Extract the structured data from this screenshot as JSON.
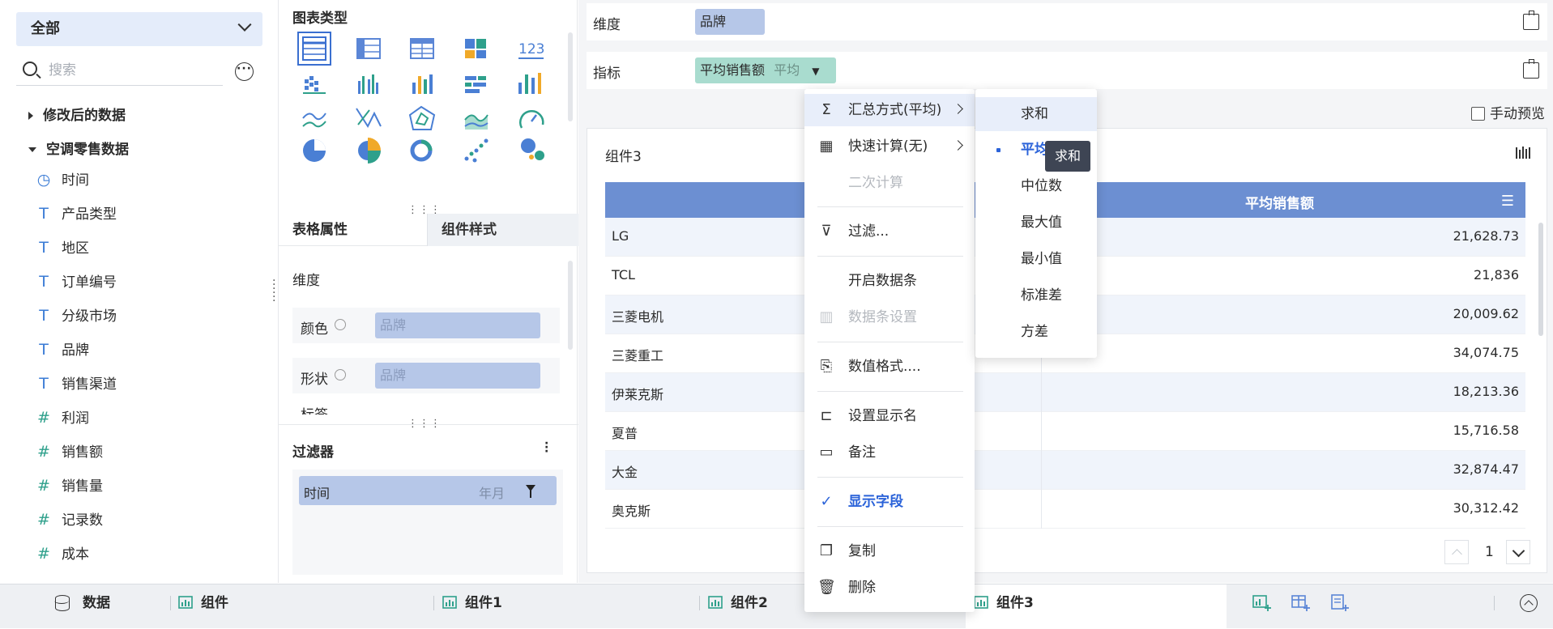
{
  "left": {
    "scope_select": "全部",
    "search_placeholder": "搜索",
    "groups": [
      {
        "label": "修改后的数据",
        "expanded": false
      },
      {
        "label": "空调零售数据",
        "expanded": true
      }
    ],
    "fields": [
      {
        "label": "时间",
        "icon": "clock-icon"
      },
      {
        "label": "产品类型",
        "icon": "text-field-icon"
      },
      {
        "label": "地区",
        "icon": "text-field-icon"
      },
      {
        "label": "订单编号",
        "icon": "text-field-icon"
      },
      {
        "label": "分级市场",
        "icon": "text-field-icon"
      },
      {
        "label": "品牌",
        "icon": "text-field-icon"
      },
      {
        "label": "销售渠道",
        "icon": "text-field-icon"
      },
      {
        "label": "利润",
        "icon": "number-field-icon"
      },
      {
        "label": "销售额",
        "icon": "number-field-icon"
      },
      {
        "label": "销售量",
        "icon": "number-field-icon"
      },
      {
        "label": "记录数",
        "icon": "record-count-icon"
      },
      {
        "label": "成本",
        "icon": "calculated-field-icon"
      }
    ]
  },
  "middle": {
    "chart_type_title": "图表类型",
    "tabs": {
      "table_props": "表格属性",
      "component_style": "组件样式"
    },
    "dimension_label": "维度",
    "props": [
      {
        "label": "颜色",
        "slot": "品牌"
      },
      {
        "label": "形状",
        "slot": "品牌"
      }
    ],
    "truncated_label": "标签",
    "filter_title": "过滤器",
    "filter_chip": {
      "name": "时间",
      "granularity": "年月"
    }
  },
  "right": {
    "dimension_shelf": {
      "label": "维度",
      "chip": "品牌"
    },
    "metric_shelf": {
      "label": "指标",
      "chip": "平均销售额",
      "agg": "平均"
    },
    "manual_preview": "手动预览",
    "component_title": "组件3",
    "table": {
      "columns": [
        "",
        "平均销售额"
      ],
      "rows": [
        {
          "brand": "LG",
          "value": "21,628.73"
        },
        {
          "brand": "TCL",
          "value": "21,836"
        },
        {
          "brand": "三菱电机",
          "value": "20,009.62"
        },
        {
          "brand": "三菱重工",
          "value": "34,074.75"
        },
        {
          "brand": "伊莱克斯",
          "value": "18,213.36"
        },
        {
          "brand": "夏普",
          "value": "15,716.58"
        },
        {
          "brand": "大金",
          "value": "32,874.47"
        },
        {
          "brand": "奥克斯",
          "value": "30,312.42"
        }
      ]
    },
    "page_number": "1"
  },
  "context_menu": {
    "items": [
      {
        "label": "汇总方式(平均)",
        "icon": "sigma-icon"
      },
      {
        "label": "快速计算(无)",
        "icon": "calculator-icon"
      },
      {
        "label": "二次计算",
        "icon": ""
      },
      {
        "label": "过滤...",
        "icon": "filter-icon"
      },
      {
        "label": "开启数据条",
        "icon": ""
      },
      {
        "label": "数据条设置",
        "icon": "databar-icon"
      },
      {
        "label": "数值格式....",
        "icon": "number-format-icon"
      },
      {
        "label": "设置显示名",
        "icon": "rename-icon"
      },
      {
        "label": "备注",
        "icon": "comment-icon"
      },
      {
        "label": "显示字段",
        "icon": "check-icon"
      },
      {
        "label": "复制",
        "icon": "copy-icon"
      },
      {
        "label": "删除",
        "icon": "trash-icon"
      }
    ]
  },
  "agg_submenu": {
    "items": [
      "求和",
      "平均",
      "中位数",
      "最大值",
      "最小值",
      "标准差",
      "方差"
    ],
    "selected": "平均",
    "hovered": "求和"
  },
  "tooltip": "求和",
  "bottom_tabs": [
    "数据",
    "组件",
    "组件1",
    "组件2",
    "组件3"
  ],
  "colors": {
    "accent": "#2b63d9",
    "table_header": "#6c8fd2",
    "chip_blue": "#b6c7e8",
    "chip_teal": "#a9dccf"
  }
}
